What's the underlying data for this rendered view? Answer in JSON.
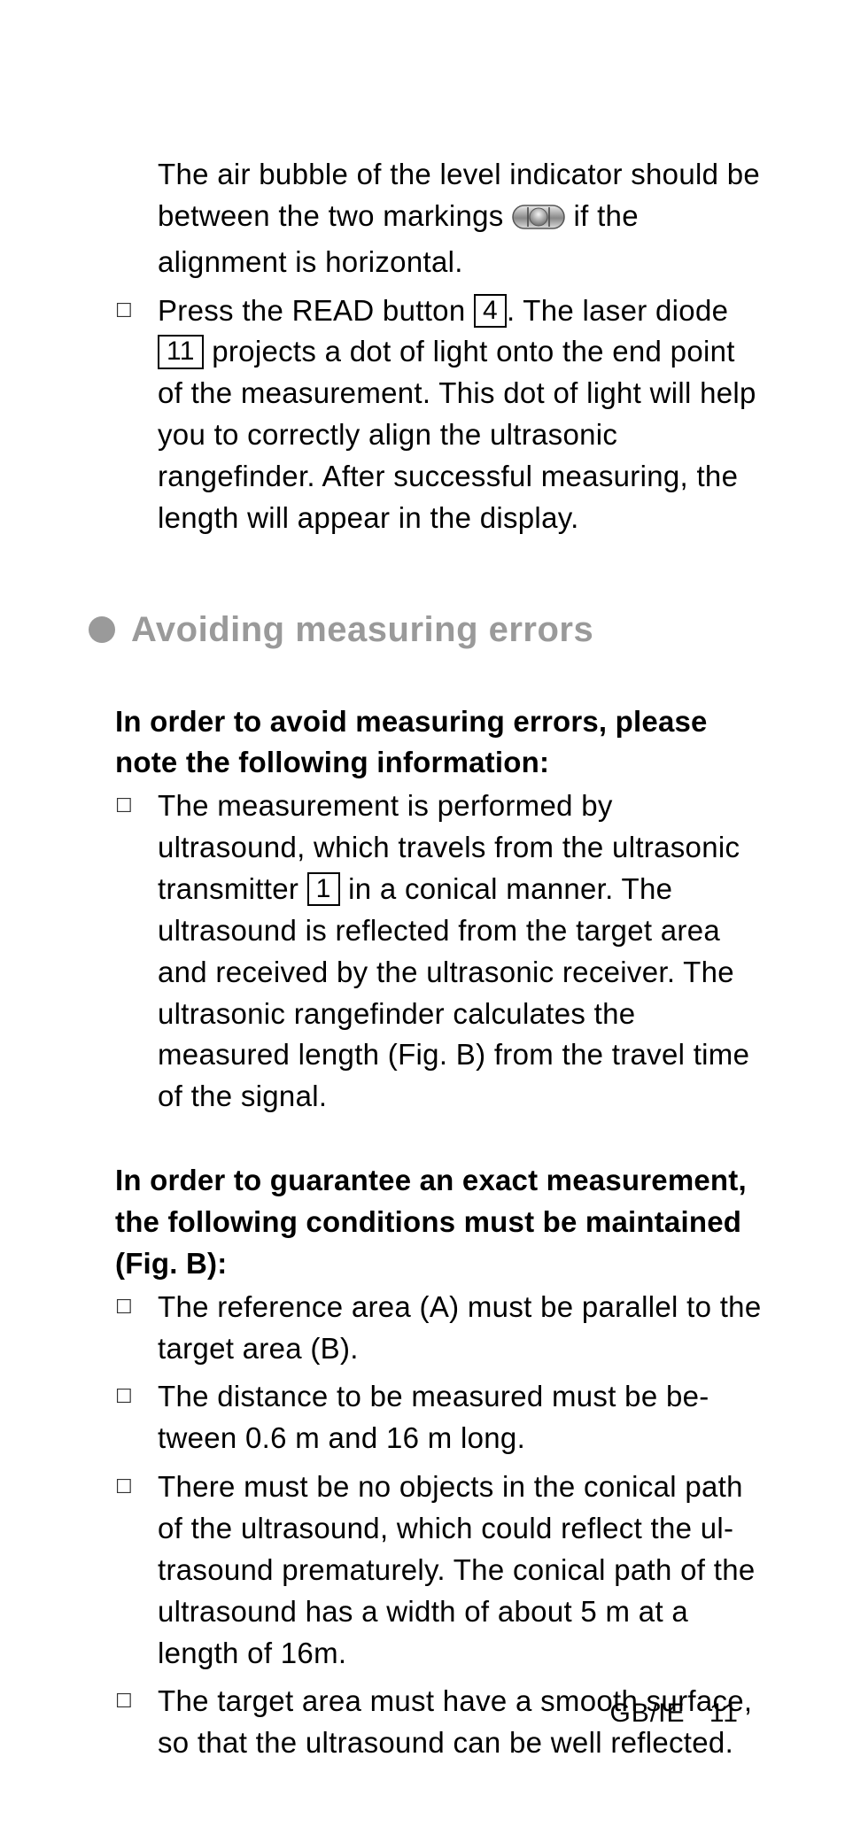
{
  "intro": {
    "p1a": "The air bubble of the level indicator should be between the two markings ",
    "p1b": " if the alignment is horizontal.",
    "b1a": "Press the READ button ",
    "ref4": "4",
    "b1b": ". The laser diode ",
    "ref11": "11",
    "b1c": " projects a dot of light onto the end point of the measurement. This dot of light will help you to correctly align the ultrasonic rangefinder. After successful measuring, the length will appear in the display."
  },
  "section": {
    "title": "Avoiding measuring errors"
  },
  "avoid": {
    "intro": "In order to avoid measuring errors, please note the following information:",
    "b1a": "The measurement is performed by ultrasound, which travels from the ultrasonic transmitter ",
    "ref1": "1",
    "b1b": " in a conical manner. The ultrasound is reflected from the target area and received by the ul­trasonic receiver. The ultrasonic rangefinder calculates the measured length (Fig. B) from the travel time of the signal."
  },
  "guarantee": {
    "intro": "In order to guarantee an exact measure­ment, the following conditions must be maintained (Fig. B):",
    "b1": "The reference area (A) must be parallel to the target area (B).",
    "b2": "The distance to be measured must be be­tween 0.6 m and 16 m long.",
    "b3": "There must be no objects in the conical path of the ultrasound, which could reflect the ul­trasound prematurely. The conical path of the ultrasound has a width of about 5 m at a length of 16m.",
    "b4": "The target area must have a smooth surface, so that the ultrasound can be well reflected."
  },
  "footer": {
    "locale": "GB/IE",
    "page": "11"
  }
}
